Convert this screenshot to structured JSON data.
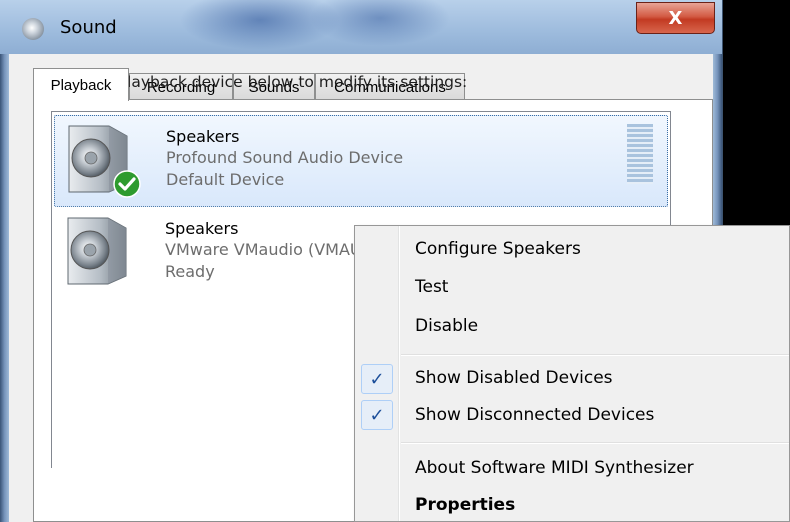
{
  "window": {
    "title": "Sound",
    "close_glyph": "X"
  },
  "tabs": [
    {
      "label": "Playback",
      "active": true
    },
    {
      "label": "Recording",
      "active": false
    },
    {
      "label": "Sounds",
      "active": false
    },
    {
      "label": "Communications",
      "active": false
    }
  ],
  "instruction": "Select a playback device below to modify its settings:",
  "devices": [
    {
      "name": "Speakers",
      "description": "Profound Sound Audio Device",
      "status": "Default Device",
      "selected": true,
      "default": true
    },
    {
      "name": "Speakers",
      "description": "VMware VMaudio (VMAUDIO)",
      "status": "Ready",
      "selected": false,
      "default": false
    }
  ],
  "context_menu": {
    "items": [
      {
        "label": "Configure Speakers"
      },
      {
        "label": "Test"
      },
      {
        "label": "Disable"
      },
      {
        "label": "Show Disabled Devices",
        "checked": true
      },
      {
        "label": "Show Disconnected Devices",
        "checked": true
      },
      {
        "label": "About Software MIDI Synthesizer"
      },
      {
        "label": "Properties",
        "bold": true
      }
    ],
    "check_glyph": "✓"
  },
  "colors": {
    "selection_bg": "#d9e8fb",
    "close_red": "#c23a22",
    "check_blue": "#1d4f9a",
    "default_check_green": "#2e9b2e"
  },
  "icons": {
    "window_icon": "speaker-icon",
    "device_icon": "speaker-icon",
    "default_badge": "green-check-icon"
  }
}
